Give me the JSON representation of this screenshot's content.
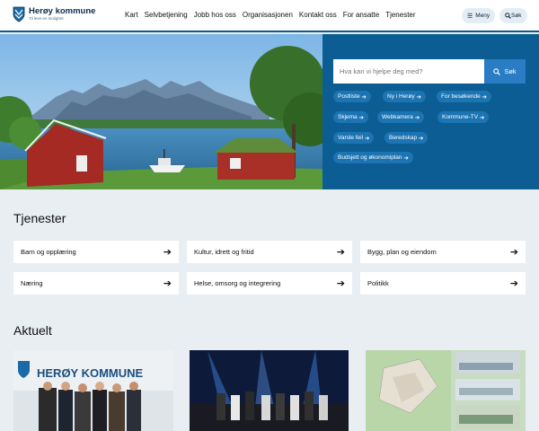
{
  "header": {
    "logo_title": "Herøy kommune",
    "logo_sub": "Til leve en mulighet",
    "nav": [
      "Kart",
      "Selvbetjening",
      "Jobb hos oss",
      "Organisasjonen",
      "Kontakt oss",
      "For ansatte",
      "Tjenester"
    ],
    "menu_label": "Meny",
    "search_label": "Søk"
  },
  "hero": {
    "search_placeholder": "Hva kan vi hjelpe deg med?",
    "search_button": "Søk",
    "chips": [
      "Postliste",
      "Ny i Herøy",
      "For besøkende",
      "Skjema",
      "Webkamera",
      "Kommune-TV",
      "Varsle feil",
      "Beredskap",
      "Budsjett og økonomiplan"
    ]
  },
  "services": {
    "title": "Tjenester",
    "items": [
      "Barn og opplæring",
      "Kultur, idrett og fritid",
      "Bygg, plan og eiendom",
      "Næring",
      "Helse, omsorg og integrering",
      "Politikk"
    ]
  },
  "news": {
    "title": "Aktuelt",
    "sign_text": "HERØY KOMMUNE"
  },
  "colors": {
    "brand": "#0b5d93",
    "chip": "#1c74b3",
    "search_button": "#2a7cc4"
  }
}
